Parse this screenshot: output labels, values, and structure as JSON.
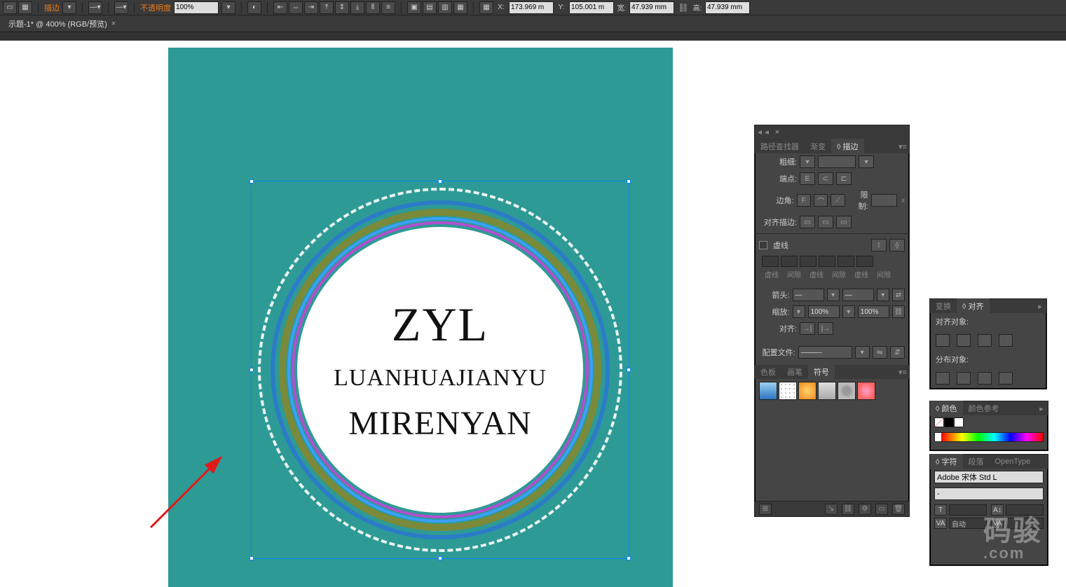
{
  "toolbar": {
    "stroke_label": "描边",
    "opacity_label": "不透明度",
    "opacity_value": "100%",
    "x_label": "X:",
    "y_label": "Y:",
    "w_label": "宽:",
    "h_label": "高:",
    "x_value": "173.969 m",
    "y_value": "105.001 m",
    "w_value": "47.939 mm",
    "h_value": "47.939 mm"
  },
  "tabstrip": {
    "doc_title": "示题-1* @ 400% (RGB/预览)"
  },
  "artwork": {
    "line1": "ZYL",
    "line2": "LUANHUAJIANYU",
    "line3": "MIRENYAN"
  },
  "stroke_panel": {
    "tabs": {
      "pathfinder": "路径查找器",
      "gradient": "渐变",
      "stroke": "◊ 描边"
    },
    "weight_label": "粗细:",
    "cap_label": "端点:",
    "corner_label": "边角:",
    "limit_label": "限制:",
    "align_stroke_label": "对齐描边:",
    "dashed_label": "虚线",
    "dash_cols": [
      "虚线",
      "间隙",
      "虚线",
      "间隙",
      "虚线",
      "间隙"
    ],
    "arrow_label": "箭头:",
    "scale_label": "缩放:",
    "scale_value_left": "100%",
    "scale_value_right": "100%",
    "align_label": "对齐:",
    "profile_label": "配置文件:",
    "sub_tabs": {
      "swatches": "色板",
      "brushes": "画笔",
      "symbols": "符号"
    }
  },
  "align_panel": {
    "tabs": {
      "transform": "变换",
      "align": "◊ 对齐"
    },
    "align_objects_label": "对齐对象:",
    "distribute_label": "分布对象:"
  },
  "color_panel": {
    "tabs": {
      "color": "◊ 颜色",
      "guide": "颜色参考"
    }
  },
  "char_panel": {
    "tabs": {
      "character": "◊ 字符",
      "paragraph": "段落",
      "opentype": "OpenType"
    },
    "font_name": "Adobe 宋体 Std L",
    "font_style": "-",
    "kerning_value": "自动"
  },
  "watermark": {
    "brand": "码骏",
    "suffix": ".com"
  }
}
